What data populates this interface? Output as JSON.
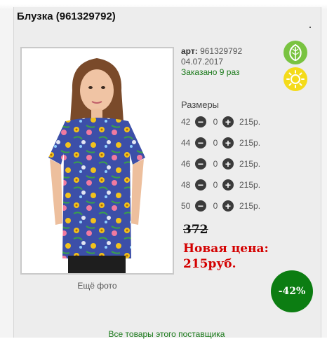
{
  "product": {
    "title": "Блузка (961329792)",
    "art_label": "арт:",
    "art_value": "961329792",
    "date": "04.07.2017",
    "ordered": "Заказано 9 раз",
    "more_photos": "Ещё фото"
  },
  "badges": {
    "leaf_icon": "leaf-icon",
    "sun_icon": "sun-icon",
    "leaf_color": "#79c341",
    "sun_color": "#f4db1a"
  },
  "sizes": {
    "title": "Размеры",
    "rows": [
      {
        "size": "42",
        "qty": "0",
        "price": "215р."
      },
      {
        "size": "44",
        "qty": "0",
        "price": "215р."
      },
      {
        "size": "46",
        "qty": "0",
        "price": "215р."
      },
      {
        "size": "48",
        "qty": "0",
        "price": "215р."
      },
      {
        "size": "50",
        "qty": "0",
        "price": "215р."
      }
    ],
    "minus_symbol": "−",
    "plus_symbol": "+"
  },
  "pricing": {
    "old_price": "372",
    "new_price": "Новая цена: 215руб.",
    "discount": "-42%",
    "new_price_color": "#d40000",
    "discount_color": "#0c7d12"
  },
  "footer": {
    "supplier_link": "Все товары этого поставщика"
  }
}
